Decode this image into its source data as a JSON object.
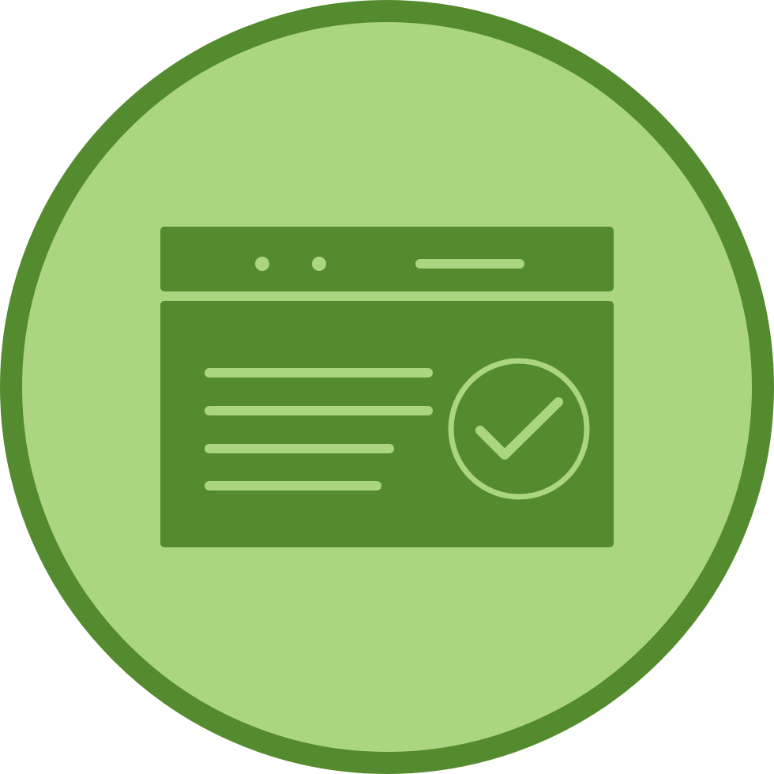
{
  "icon": {
    "name": "verified-webpage-icon",
    "components": [
      "circle-badge",
      "browser-window",
      "window-dots",
      "address-bar",
      "text-lines",
      "check-circle"
    ]
  },
  "colors": {
    "badge_fill": "#acd582",
    "badge_ring": "#558b2f",
    "window_fill": "#558b2f",
    "accent": "#acd582",
    "page_background": "#ffffff"
  }
}
